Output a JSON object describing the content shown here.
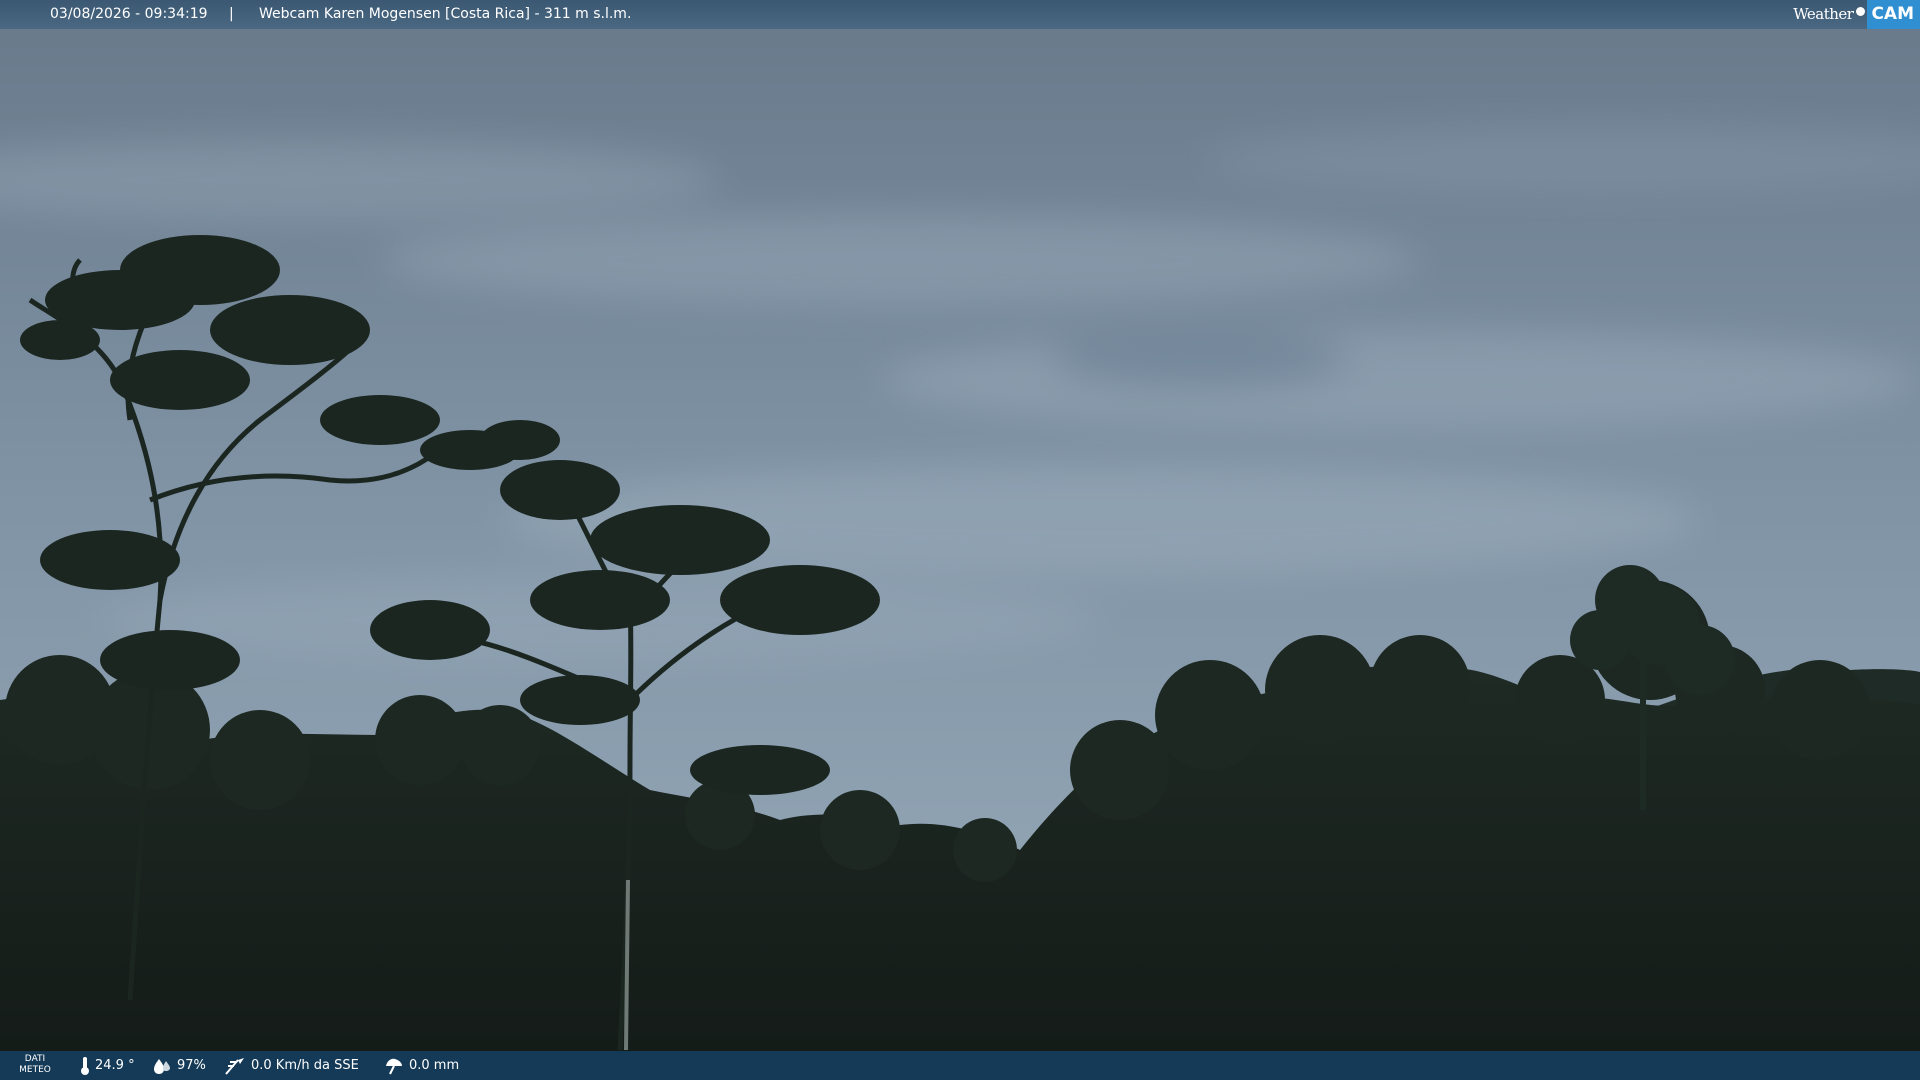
{
  "header": {
    "timestamp": "03/08/2026 - 09:34:19",
    "separator": "|",
    "title": "Webcam Karen Mogensen [Costa Rica]  - 311 m s.l.m."
  },
  "logo": {
    "word": "Weather",
    "cam": "CAM"
  },
  "footer": {
    "dati_line1": "DATI",
    "dati_line2": "METEO",
    "temperature": "24.9 °",
    "humidity": "97%",
    "wind": "0.0 Km/h da SSE",
    "rain": "0.0 mm",
    "icons": [
      "thermometer-icon",
      "humidity-drop-icon",
      "wind-icon",
      "rain-umbrella-icon"
    ]
  },
  "colors": {
    "sky_top": "#6f8396",
    "sky_bottom": "#8ea2b3",
    "foliage": "#1c2620",
    "top_bar": "#3f5c77",
    "bottom_bar": "#143a57",
    "logo_accent": "#2f8fd0"
  }
}
